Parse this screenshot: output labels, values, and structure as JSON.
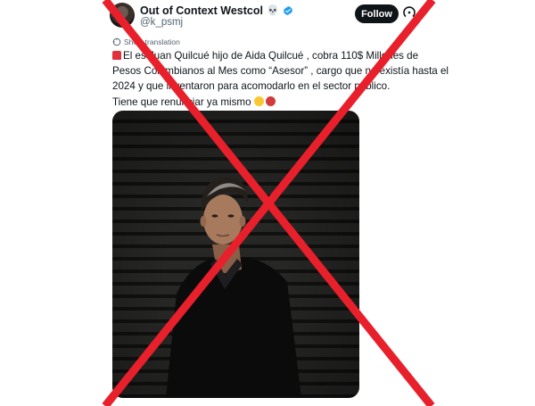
{
  "post": {
    "display_name": "Out of Context Westcol",
    "name_emoji": "💀",
    "handle": "@k_psmj",
    "follow_label": "Follow",
    "translation_label": "Show translation",
    "text_lines": [
      "El es Juan  Quilcué hijo de Aida Quilcué , cobra 110$ Millones de",
      "Pesos Colombianos al Mes como “Asesor” , cargo que no existía hasta el",
      "2024 y que inventaron para acomodarlo en el sector público.",
      "Tiene que renunciar ya mismo"
    ]
  },
  "icons": {
    "verified": "verified-badge-icon",
    "more": "more-options-icon",
    "translate": "translate-icon",
    "siren": "police-light-emoji",
    "face": "face-with-rolling-eyes-emoji",
    "rage": "angry-face-emoji"
  },
  "colors": {
    "verified": "#1d9bf0",
    "follow_bg": "#0f1419",
    "cross": "#e8202b"
  }
}
